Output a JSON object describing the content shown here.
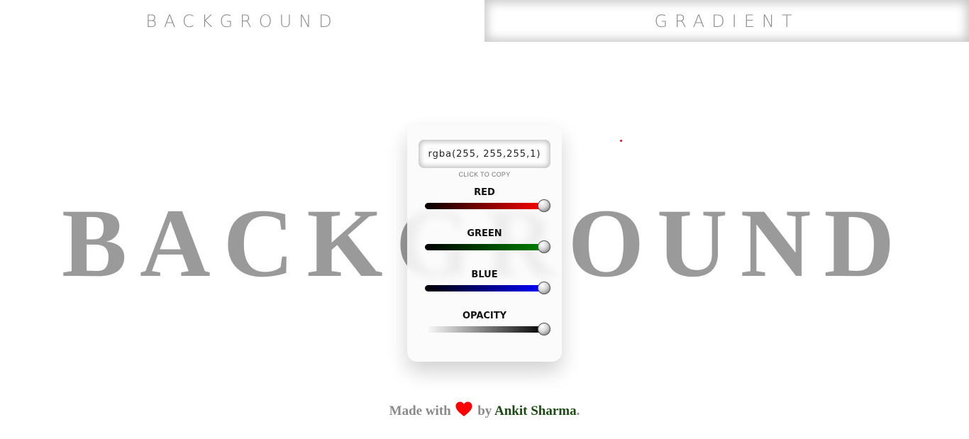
{
  "tabs": [
    {
      "label": "BACKGROUND",
      "style": "plain"
    },
    {
      "label": "GRADIENT",
      "style": "inset"
    }
  ],
  "big_title": "BACKGROUND",
  "picker": {
    "rgba_value": "rgba(255, 255,255,1)",
    "copy_hint": "CLICK TO COPY",
    "sliders": [
      {
        "label": "RED",
        "value": 255,
        "max": 255,
        "gradient_from": "#000000",
        "gradient_to": "#ff0000"
      },
      {
        "label": "GREEN",
        "value": 255,
        "max": 255,
        "gradient_from": "#000000",
        "gradient_to": "#008000"
      },
      {
        "label": "BLUE",
        "value": 255,
        "max": 255,
        "gradient_from": "#000000",
        "gradient_to": "#0000ff"
      },
      {
        "label": "OPACITY",
        "value": 1,
        "max": 1,
        "gradient_from": "#ffffff",
        "gradient_to": "#000000"
      }
    ]
  },
  "footer": {
    "made_with": "Made with",
    "by": "by",
    "author": "Ankit Sharma",
    "period": ".",
    "heart_color": "#ff0000",
    "heart_icon": "heart-icon"
  },
  "colors": {
    "title_gray": "#9a9a9a",
    "author_green": "#1a4a12"
  }
}
